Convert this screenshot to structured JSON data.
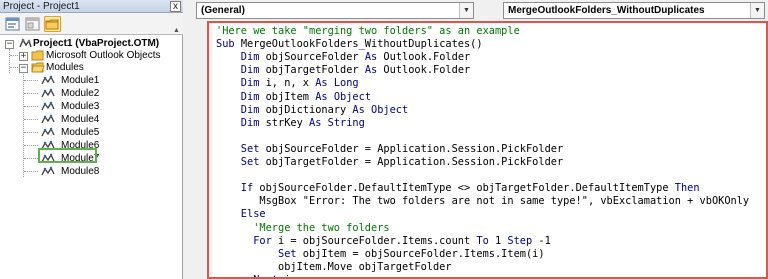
{
  "project_explorer": {
    "title": "Project - Project1",
    "close_glyph": "x",
    "toolbar": {
      "view_code_icon": "view-code-icon",
      "view_object_icon": "view-object-icon",
      "toggle_folders_icon": "folder-icon"
    },
    "tree": {
      "project_label": "Project1 (VbaProject.OTM)",
      "outlook_objects_label": "Microsoft Outlook Objects",
      "modules_label": "Modules",
      "modules": [
        "Module1",
        "Module2",
        "Module3",
        "Module4",
        "Module5",
        "Module6",
        "Module7",
        "Module8"
      ],
      "highlighted_module": "Module7"
    }
  },
  "code_window": {
    "object_combo": "(General)",
    "procedure_combo": "MergeOutlookFolders_WithoutDuplicates",
    "colors": {
      "keyword": "#00008b",
      "comment": "#007800",
      "highlight_border": "#e2554a",
      "module_highlight": "#5fb34a"
    },
    "lines": [
      [
        {
          "t": "'Here we take \"merging two folders\" as an example",
          "c": "cm"
        }
      ],
      [
        {
          "t": "Sub ",
          "c": "kw"
        },
        {
          "t": "MergeOutlookFolders_WithoutDuplicates()",
          "c": "tx"
        }
      ],
      [
        {
          "t": "    Dim ",
          "c": "kw"
        },
        {
          "t": "objSourceFolder ",
          "c": "tx"
        },
        {
          "t": "As ",
          "c": "kw"
        },
        {
          "t": "Outlook.Folder",
          "c": "tx"
        }
      ],
      [
        {
          "t": "    Dim ",
          "c": "kw"
        },
        {
          "t": "objTargetFolder ",
          "c": "tx"
        },
        {
          "t": "As ",
          "c": "kw"
        },
        {
          "t": "Outlook.Folder",
          "c": "tx"
        }
      ],
      [
        {
          "t": "    Dim ",
          "c": "kw"
        },
        {
          "t": "i, n, x ",
          "c": "tx"
        },
        {
          "t": "As Long",
          "c": "kw"
        }
      ],
      [
        {
          "t": "    Dim ",
          "c": "kw"
        },
        {
          "t": "objItem ",
          "c": "tx"
        },
        {
          "t": "As Object",
          "c": "kw"
        }
      ],
      [
        {
          "t": "    Dim ",
          "c": "kw"
        },
        {
          "t": "objDictionary ",
          "c": "tx"
        },
        {
          "t": "As Object",
          "c": "kw"
        }
      ],
      [
        {
          "t": "    Dim ",
          "c": "kw"
        },
        {
          "t": "strKey ",
          "c": "tx"
        },
        {
          "t": "As String",
          "c": "kw"
        }
      ],
      [],
      [
        {
          "t": "    Set ",
          "c": "kw"
        },
        {
          "t": "objSourceFolder = Application.Session.PickFolder",
          "c": "tx"
        }
      ],
      [
        {
          "t": "    Set ",
          "c": "kw"
        },
        {
          "t": "objTargetFolder = Application.Session.PickFolder",
          "c": "tx"
        }
      ],
      [],
      [
        {
          "t": "    If ",
          "c": "kw"
        },
        {
          "t": "objSourceFolder.DefaultItemType <> objTargetFolder.DefaultItemType ",
          "c": "tx"
        },
        {
          "t": "Then",
          "c": "kw"
        }
      ],
      [
        {
          "t": "       MsgBox \"Error: The two folders are not in same type!\", vbExclamation + vbOKOnly",
          "c": "tx"
        }
      ],
      [
        {
          "t": "    Else",
          "c": "kw"
        }
      ],
      [
        {
          "t": "      'Merge the two folders",
          "c": "cm"
        }
      ],
      [
        {
          "t": "      For ",
          "c": "kw"
        },
        {
          "t": "i = objSourceFolder.Items.count ",
          "c": "tx"
        },
        {
          "t": "To ",
          "c": "kw"
        },
        {
          "t": "1 ",
          "c": "tx"
        },
        {
          "t": "Step ",
          "c": "kw"
        },
        {
          "t": "-1",
          "c": "tx"
        }
      ],
      [
        {
          "t": "          Set ",
          "c": "kw"
        },
        {
          "t": "objItem = objSourceFolder.Items.Item(i)",
          "c": "tx"
        }
      ],
      [
        {
          "t": "          objItem.Move objTargetFolder",
          "c": "tx"
        }
      ],
      [
        {
          "t": "      Next ",
          "c": "kw"
        },
        {
          "t": "i",
          "c": "tx"
        }
      ]
    ]
  }
}
